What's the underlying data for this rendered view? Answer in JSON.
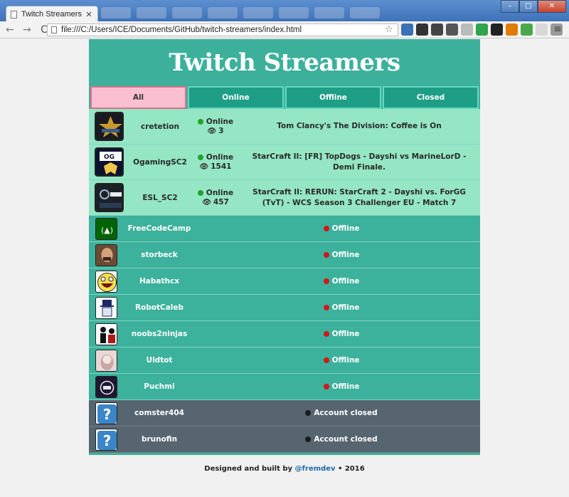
{
  "browser": {
    "tab_title": "Twitch Streamers",
    "tab_close": "✕",
    "url": "file:///C:/Users/ICE/Documents/GitHub/twitch-streamers/index.html",
    "back": "←",
    "forward": "→",
    "reload": "C",
    "star": "☆",
    "menu": "≡",
    "win_min": "–",
    "win_max": "□",
    "win_close": "✕"
  },
  "app": {
    "title": "Twitch Streamers",
    "filters": [
      "All",
      "Online",
      "Offline",
      "Closed"
    ],
    "active_filter": "All",
    "online": [
      {
        "name": "cretetion",
        "status": "Online",
        "viewers": "3",
        "title": "Tom Clancy's The Division: Coffee is On",
        "avatar_colors": [
          "#1a1a22",
          "#c89b2c"
        ]
      },
      {
        "name": "OgamingSC2",
        "status": "Online",
        "viewers": "1541",
        "title": "StarCraft II: [FR] TopDogs - Dayshi vs MarineLorD - Demi Finale.",
        "avatar_colors": [
          "#0c1230",
          "#f0c64a"
        ]
      },
      {
        "name": "ESL_SC2",
        "status": "Online",
        "viewers": "457",
        "title": "StarCraft II: RERUN: StarCraft 2 - Dayshi vs. ForGG (TvT) - WCS Season 3 Challenger EU - Match 7",
        "avatar_colors": [
          "#1c2028",
          "#9fb7c9"
        ]
      }
    ],
    "offline": [
      {
        "name": "FreeCodeCamp",
        "status": "Offline",
        "avatar_colors": [
          "#006400",
          "#ffffff"
        ]
      },
      {
        "name": "storbeck",
        "status": "Offline",
        "avatar_colors": [
          "#6b4a36",
          "#d3a37c"
        ]
      },
      {
        "name": "Habathcx",
        "status": "Offline",
        "avatar_colors": [
          "#f6e04a",
          "#222222"
        ]
      },
      {
        "name": "RobotCaleb",
        "status": "Offline",
        "avatar_colors": [
          "#ffffff",
          "#1b2a66"
        ]
      },
      {
        "name": "noobs2ninjas",
        "status": "Offline",
        "avatar_colors": [
          "#ffffff",
          "#111111"
        ]
      },
      {
        "name": "Uldtot",
        "status": "Offline",
        "avatar_colors": [
          "#e8d8d8",
          "#c9a6a6"
        ]
      },
      {
        "name": "Puchmi",
        "status": "Offline",
        "avatar_colors": [
          "#1e1832",
          "#e8e8f0"
        ]
      }
    ],
    "closed": [
      {
        "name": "comster404",
        "status": "Account closed",
        "avatar_glyph": "?"
      },
      {
        "name": "brunofin",
        "status": "Account closed",
        "avatar_glyph": "?"
      }
    ]
  },
  "footer": {
    "prefix": "Designed and built by",
    "author": "@fremdev",
    "suffix": "• 2016"
  },
  "colors": {
    "teal": "#3cb19c",
    "online_row": "#94e6c4",
    "closed_row": "#566570",
    "active_filter": "#fbbfd2",
    "online_dot": "#22a32c",
    "offline_dot": "#d4151b"
  }
}
